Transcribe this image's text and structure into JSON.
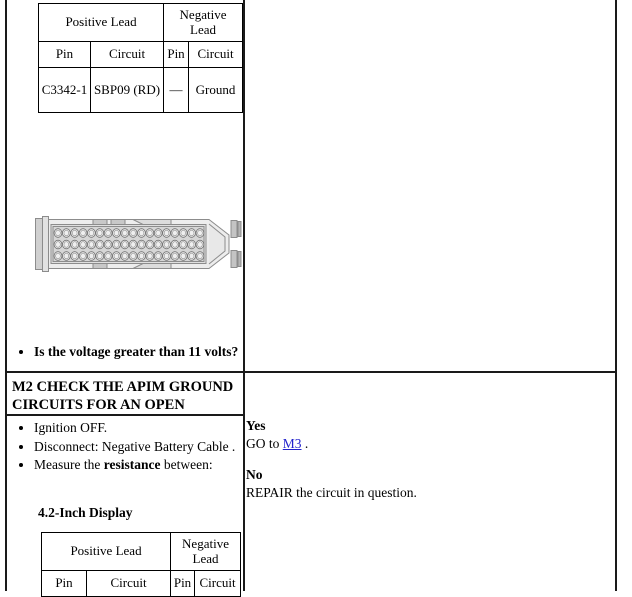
{
  "document": {
    "type": "vehicle-diagnostic-pinpoint-test"
  },
  "top_section": {
    "table": {
      "group_headers": [
        "Positive Lead",
        "Negative Lead"
      ],
      "column_headers": [
        "Pin",
        "Circuit",
        "Pin",
        "Circuit"
      ],
      "rows": [
        [
          "C3342-1",
          "SBP09 (RD)",
          "—",
          "Ground"
        ]
      ]
    },
    "figure": {
      "name": "connector-pin-view",
      "rows_of_pins": 3,
      "pins_per_row": 18
    },
    "question": "Is the voltage greater than 11 volts?"
  },
  "m2_section": {
    "heading": "M2 CHECK THE APIM GROUND CIRCUITS FOR AN OPEN",
    "steps": [
      {
        "prefix": "Ignition OFF.",
        "bold": "",
        "suffix": ""
      },
      {
        "prefix": "Disconnect: Negative Battery Cable .",
        "bold": "",
        "suffix": ""
      },
      {
        "prefix": "Measure the ",
        "bold": "resistance",
        "suffix": " between:"
      }
    ],
    "subcaption": "4.2-Inch Display",
    "table": {
      "group_headers": [
        "Positive Lead",
        "Negative Lead"
      ],
      "column_headers": [
        "Pin",
        "Circuit",
        "Pin",
        "Circuit"
      ]
    },
    "answers": {
      "yes_label": "Yes",
      "yes_text_before": "GO to ",
      "yes_link": "M3",
      "yes_text_after": " .",
      "no_label": "No",
      "no_text": "REPAIR the circuit in question."
    }
  },
  "colors": {
    "link": "#2222cc",
    "border": "#1a1a1a",
    "connector_fill": "#d8d8d8",
    "connector_line": "#808080"
  }
}
